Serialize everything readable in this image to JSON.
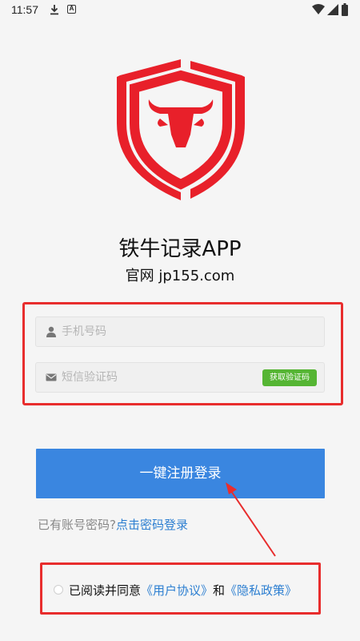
{
  "status_bar": {
    "time": "11:57",
    "a_badge": "A"
  },
  "app": {
    "name": "铁牛记录APP",
    "website": "官网 jp155.com"
  },
  "form": {
    "phone_placeholder": "手机号码",
    "code_placeholder": "短信验证码",
    "get_code_label": "获取验证码",
    "accent_color": "#55b533"
  },
  "login_button": {
    "label": "一键注册登录",
    "color": "#3a86e0"
  },
  "password_login": {
    "prompt": "已有账号密码?",
    "link": "点击密码登录"
  },
  "agreement": {
    "prefix": "已阅读并同意",
    "user_agreement": "《用户协议》",
    "conjunction": "和",
    "privacy_policy": "《隐私政策》",
    "checked": false
  },
  "highlight_color": "#e82d2d"
}
